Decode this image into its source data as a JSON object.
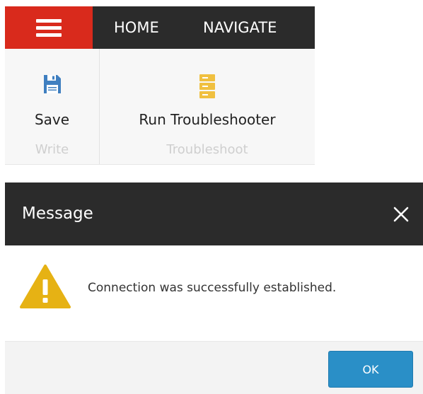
{
  "ribbon": {
    "menu_icon": "hamburger-menu-icon",
    "tabs": [
      {
        "label": "HOME"
      },
      {
        "label": "NAVIGATE"
      }
    ],
    "groups": [
      {
        "label": "Write",
        "buttons": [
          {
            "label": "Save",
            "icon": "floppy-disk-icon",
            "icon_color": "#3f7fc0"
          }
        ]
      },
      {
        "label": "Troubleshoot",
        "buttons": [
          {
            "label": "Run Troubleshooter",
            "icon": "server-rack-icon",
            "icon_color": "#f0c040"
          }
        ]
      }
    ],
    "colors": {
      "menu_bg": "#d92a1c",
      "tabbar_bg": "#2b2b2b"
    }
  },
  "dialog": {
    "title": "Message",
    "close_icon": "close-icon",
    "icon": "warning-icon",
    "message": "Connection was successfully established.",
    "ok_label": "OK",
    "colors": {
      "header_bg": "#2b2b2b",
      "warning": "#e6b214",
      "ok_button": "#2a8fc7"
    }
  }
}
